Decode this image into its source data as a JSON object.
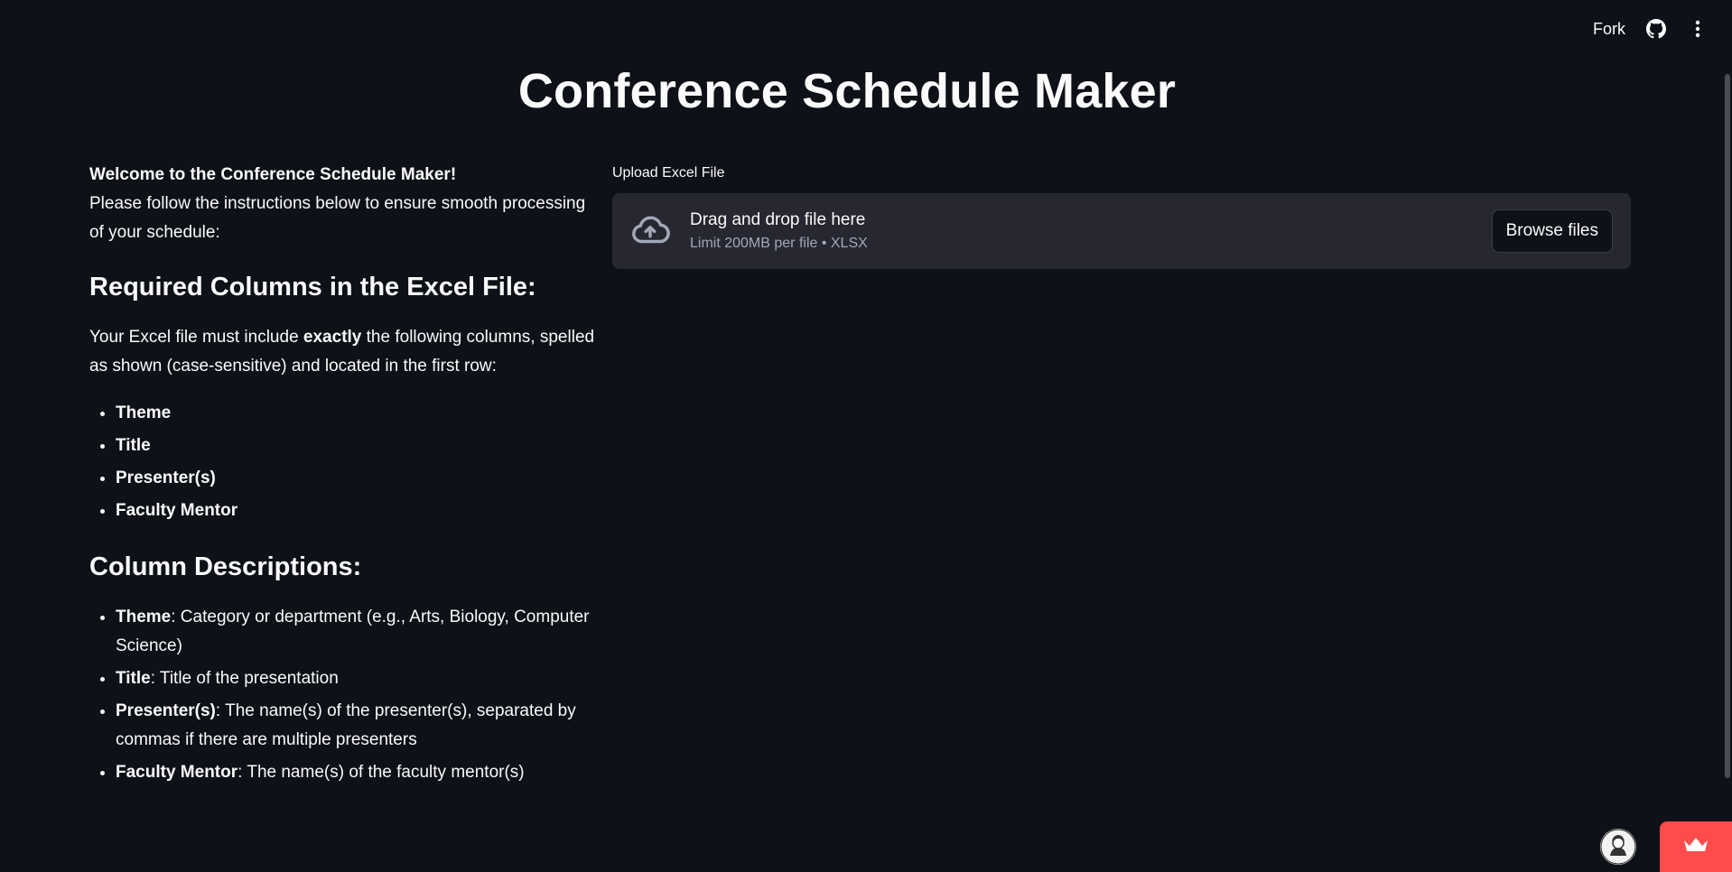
{
  "header": {
    "fork_label": "Fork",
    "github_icon": "github-icon",
    "menu_icon": "kebab-menu-icon"
  },
  "page": {
    "title": "Conference Schedule Maker"
  },
  "intro": {
    "welcome": "Welcome to the Conference Schedule Maker!",
    "instruction": "Please follow the instructions below to ensure smooth processing of your schedule:"
  },
  "required": {
    "heading": "Required Columns in the Excel File:",
    "text_before": "Your Excel file must include ",
    "text_bold": "exactly",
    "text_after": " the following columns, spelled as shown (case-sensitive) and located in the first row:",
    "columns": [
      "Theme",
      "Title",
      "Presenter(s)",
      "Faculty Mentor"
    ]
  },
  "descriptions": {
    "heading": "Column Descriptions:",
    "items": [
      {
        "name": "Theme",
        "desc": ": Category or department (e.g., Arts, Biology, Computer Science)"
      },
      {
        "name": "Title",
        "desc": ": Title of the presentation"
      },
      {
        "name": "Presenter(s)",
        "desc": ": The name(s) of the presenter(s), separated by commas if there are multiple presenters"
      },
      {
        "name": "Faculty Mentor",
        "desc": ": The name(s) of the faculty mentor(s)"
      }
    ]
  },
  "uploader": {
    "label": "Upload Excel File",
    "drag_text": "Drag and drop file here",
    "limit_text": "Limit 200MB per file • XLSX",
    "browse_label": "Browse files",
    "icon": "cloud-upload-icon"
  },
  "footer": {
    "avatar_icon": "user-avatar",
    "badge_icon": "crown-icon"
  },
  "colors": {
    "background": "#0e1117",
    "dropzone": "#262730",
    "accent": "#ff4b4b",
    "text": "#fafafa",
    "muted": "#a3a8b8"
  }
}
